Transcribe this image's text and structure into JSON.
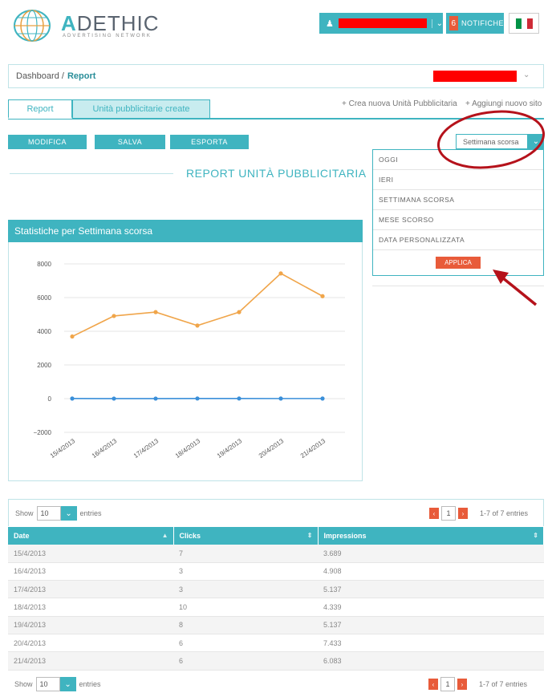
{
  "header": {
    "logo_accent": "A",
    "logo_rest": "DETHIC",
    "logo_subtitle": "ADVERTISING NETWORK",
    "notif_count": "6",
    "notif_label": "NOTIFICHE"
  },
  "breadcrumb": {
    "home": "Dashboard /",
    "current": "Report"
  },
  "tabs": {
    "report": "Report",
    "units": "Unità pubblicitarie create"
  },
  "links": {
    "create_unit": "+ Crea nuova Unità Pubblicitaria",
    "add_site": "+ Aggiungi nuovo sito"
  },
  "toolbar": {
    "edit": "MODIFICA",
    "save": "SALVA",
    "export": "ESPORTA",
    "period_selected": "Settimana scorsa"
  },
  "period_dropdown": {
    "options": [
      "OGGI",
      "IERI",
      "SETTIMANA SCORSA",
      "MESE SCORSO",
      "DATA PERSONALIZZATA"
    ],
    "apply": "APPLICA"
  },
  "report_title": "REPORT UNITÀ PUBBLICITARIA",
  "chart_panel_title": "Statistiche per Settimana scorsa",
  "chart_data": {
    "type": "line",
    "x": [
      "15/4/2013",
      "16/4/2013",
      "17/4/2013",
      "18/4/2013",
      "19/4/2013",
      "20/4/2013",
      "21/4/2013"
    ],
    "series": [
      {
        "values": [
          3689,
          4908,
          5137,
          4339,
          5137,
          7433,
          6083
        ],
        "color": "#f0a54a"
      },
      {
        "values": [
          7,
          3,
          3,
          10,
          8,
          6,
          6
        ],
        "color": "#3a8fd9"
      }
    ],
    "ylim": [
      -2000,
      8000
    ],
    "yticks": [
      -2000,
      0,
      2000,
      4000,
      6000,
      8000
    ],
    "grid": true
  },
  "table": {
    "show_label": "Show",
    "show_value": "10",
    "entries_label": "entries",
    "page": "1",
    "page_info": "1-7 of 7 entries",
    "columns": [
      "Date",
      "Clicks",
      "Impressions"
    ],
    "rows": [
      [
        "15/4/2013",
        "7",
        "3.689"
      ],
      [
        "16/4/2013",
        "3",
        "4.908"
      ],
      [
        "17/4/2013",
        "3",
        "5.137"
      ],
      [
        "18/4/2013",
        "10",
        "4.339"
      ],
      [
        "19/4/2013",
        "8",
        "5.137"
      ],
      [
        "20/4/2013",
        "6",
        "7.433"
      ],
      [
        "21/4/2013",
        "6",
        "6.083"
      ]
    ]
  },
  "colors": {
    "accent": "#3fb4c0",
    "alert": "#e85b3a",
    "annotation": "#b5121b"
  }
}
